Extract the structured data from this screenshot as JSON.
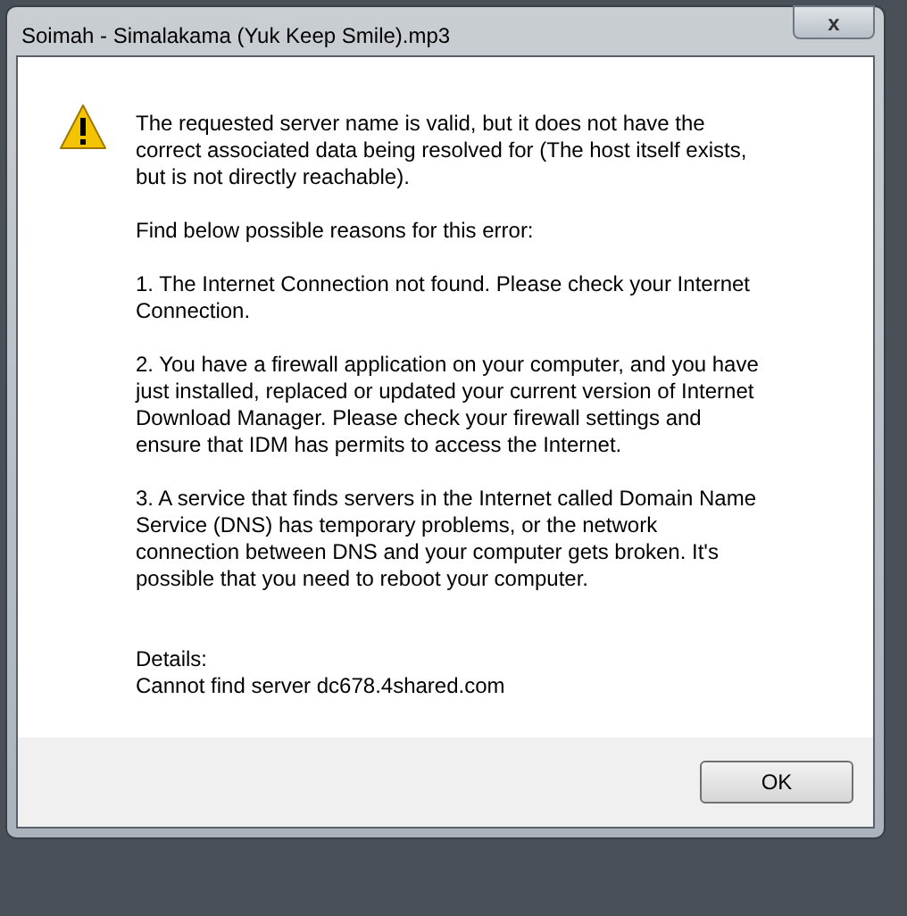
{
  "window": {
    "title": "Soimah - Simalakama (Yuk Keep Smile).mp3",
    "close_label": "x"
  },
  "message": {
    "paragraphs": [
      "The requested server name is valid, but it does not have the correct associated data being resolved for (The host itself exists, but is not directly reachable).",
      "Find below possible reasons for this error:",
      "1. The Internet Connection not found. Please check your Internet Connection.",
      "2. You have a firewall application on your computer, and you have just installed, replaced or updated your current version of Internet Download Manager. Please check your firewall settings and ensure that IDM has permits to access the Internet.",
      "3. A service that finds servers in the Internet called Domain Name Service (DNS) has temporary problems, or the network connection between DNS and your computer gets broken. It's possible that you need to reboot your computer."
    ],
    "details_label": "Details:",
    "details": "Cannot find server dc678.4shared.com"
  },
  "buttons": [
    "OK"
  ]
}
